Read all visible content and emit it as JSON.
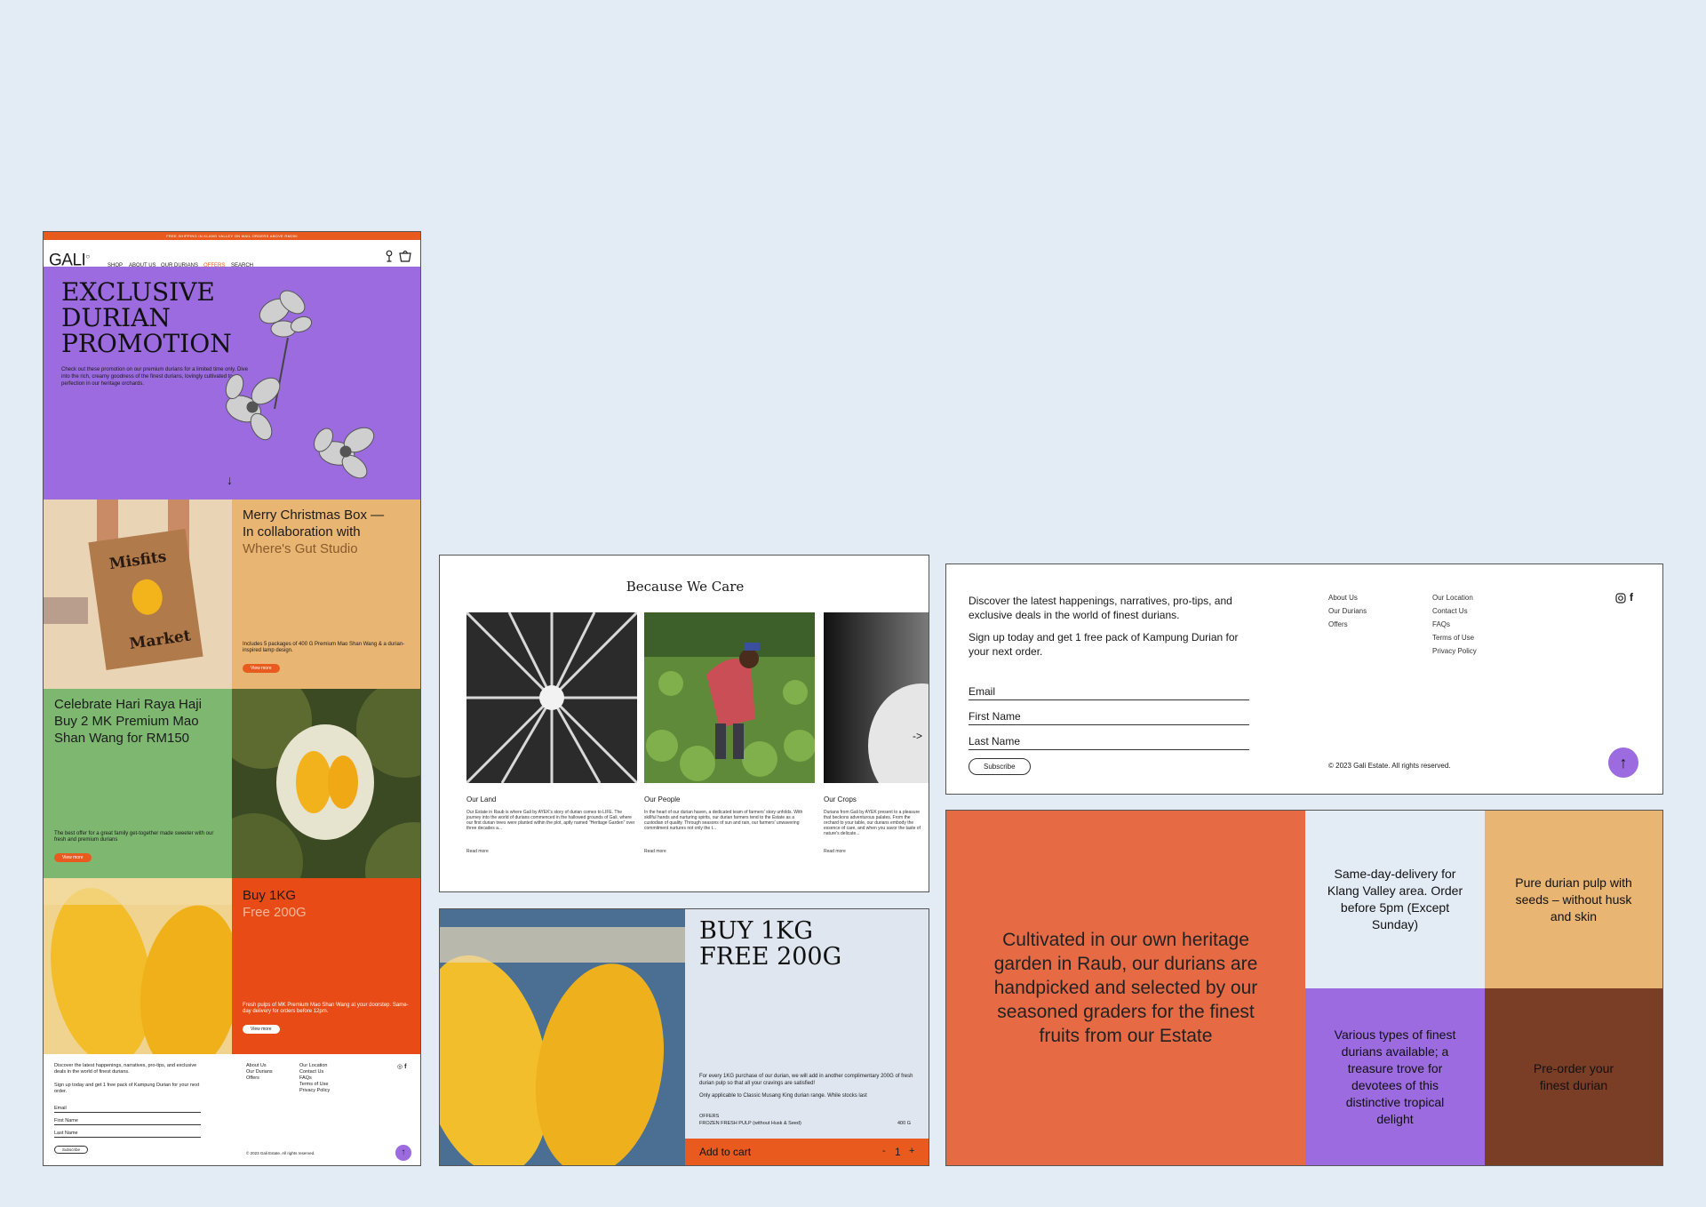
{
  "colors": {
    "page_bg": "#e3ebf4",
    "orange": "#e85a1e",
    "purple": "#9b6bdf",
    "sand": "#e8b573",
    "green": "#7db770",
    "terracotta": "#e66b45",
    "brown": "#7a3e27",
    "blue_grey": "#dfe6ef"
  },
  "site": {
    "top_banner": "FREE SHIPPING IN KLANG VALLEY ON MAIL ORDERS ABOVE RM250",
    "logo": "GALI",
    "nav": [
      "SHOP",
      "ABOUT US",
      "OUR DURIANS",
      "OFFERS",
      "SEARCH"
    ],
    "icons": [
      "account-icon",
      "cart-icon"
    ],
    "hero": {
      "title_lines": [
        "EXCLUSIVE",
        "DURIAN",
        "PROMOTION"
      ],
      "text": "Check out these promotion on our premium durians for a limited time only. Dive into the rich, creamy goodness of the finest durians, lovingly cultivated to perfection in our heritage orchards.",
      "arrow": "↓"
    },
    "tiles": {
      "christmas": {
        "title_1": "Merry Christmas Box —",
        "title_2": "In collaboration with",
        "title_3": "Where's Gut Studio",
        "desc": "Includes 5 packages of 400 G Premium Mao Shan Wang & a durian-inspired lamp design.",
        "button": "View more",
        "box_label_1": "Misfits",
        "box_label_2": "Market"
      },
      "raya": {
        "title": "Celebrate Hari Raya Haji Buy 2 MK Premium Mao Shan Wang for RM150",
        "desc": "The best offer for a great family get-together made sweeter with our fresh and premium durians",
        "button": "View more"
      },
      "buy1kg": {
        "title_1": "Buy 1KG",
        "title_2": "Free 200G",
        "desc": "Fresh pulps of MK Premium Mao Shan Wang at your doorstep. Same-day delivery for orders before 12pm.",
        "button": "View more"
      }
    },
    "footer": {
      "text_1": "Discover the latest happenings, narratives, pro-tips, and exclusive deals in the world of finest durians.",
      "text_2": "Sign up today and get 1 free pack of Kampung Durian for your next order.",
      "fields": [
        "Email",
        "First Name",
        "Last Name"
      ],
      "button": "Subscribe",
      "links_1": [
        "About Us",
        "Our Durians",
        "Offers"
      ],
      "links_2": [
        "Our Location",
        "Contact Us",
        "FAQs",
        "Terms of Use",
        "Privacy Policy"
      ],
      "copyright": "© 2023 Gali Estate. All rights reserved."
    }
  },
  "care": {
    "title": "Because We Care",
    "cards": [
      {
        "title": "Our Land",
        "text": "Our Estate in Raub is where Gali by AYEK's story of durian comes to LIFE. The journey into the world of durians commenced in the hallowed grounds of Gali, where our first durian trees were planted within the plot, aptly named \"Heritage Garden\" over three decades a...",
        "more": "Read more"
      },
      {
        "title": "Our People",
        "text": "In the heart of our durian haven, a dedicated team of farmers' story unfolds. With skillful hands and nurturing spirits, our durian farmers tend to the Estate as a custodian of quality. Through seasons of sun and rain, our farmers' unwavering commitment nurtures not only the t...",
        "more": "Read more"
      },
      {
        "title": "Our Crops",
        "text": "Durians from Gali by AYEK present to a pleasure that beckons adventurous palates. From the orchard to your table, our durians embody the essence of care, and when you savor the taste of nature's delicate...",
        "more": "Read more"
      }
    ],
    "next_arrow": "->"
  },
  "product": {
    "title_1": "BUY 1KG",
    "title_2": "FREE 200G",
    "text_1": "For every 1KG purchase of our durian, we will add in another complimentary 200G of fresh durian pulp so that all your cravings are satisfied!",
    "text_2": "Only applicable to Classic Musang King durian range. While stocks last",
    "category": "OFFERS",
    "item": "FROZEN FRESH PULP (without Husk & Seed)",
    "weight": "400 G",
    "add_to_cart": "Add to cart",
    "minus": "-",
    "qty": "1",
    "plus": "+"
  },
  "newsletter": {
    "text_1": "Discover the latest happenings, narratives, pro-tips, and exclusive deals in the world of finest durians.",
    "text_2": "Sign up today and get 1 free pack of Kampung Durian for your next order.",
    "fields": [
      "Email",
      "First Name",
      "Last Name"
    ],
    "button": "Subscribe",
    "links_1": [
      "About Us",
      "Our Durians",
      "Offers"
    ],
    "links_2": [
      "Our Location",
      "Contact Us",
      "FAQs",
      "Terms of Use",
      "Privacy Policy"
    ],
    "copyright": "© 2023 Gali Estate. All rights reserved."
  },
  "features": {
    "main": "Cultivated in our own heritage garden in Raub, our durians are handpicked and selected by our seasoned graders for the finest fruits from our Estate",
    "delivery": "Same-day-delivery for Klang Valley area. Order before 5pm (Except Sunday)",
    "pulp": "Pure durian pulp with seeds – without husk and skin",
    "types": "Various types of finest durians available; a treasure trove for devotees of this distinctive tropical delight",
    "preorder": "Pre-order your finest durian"
  }
}
